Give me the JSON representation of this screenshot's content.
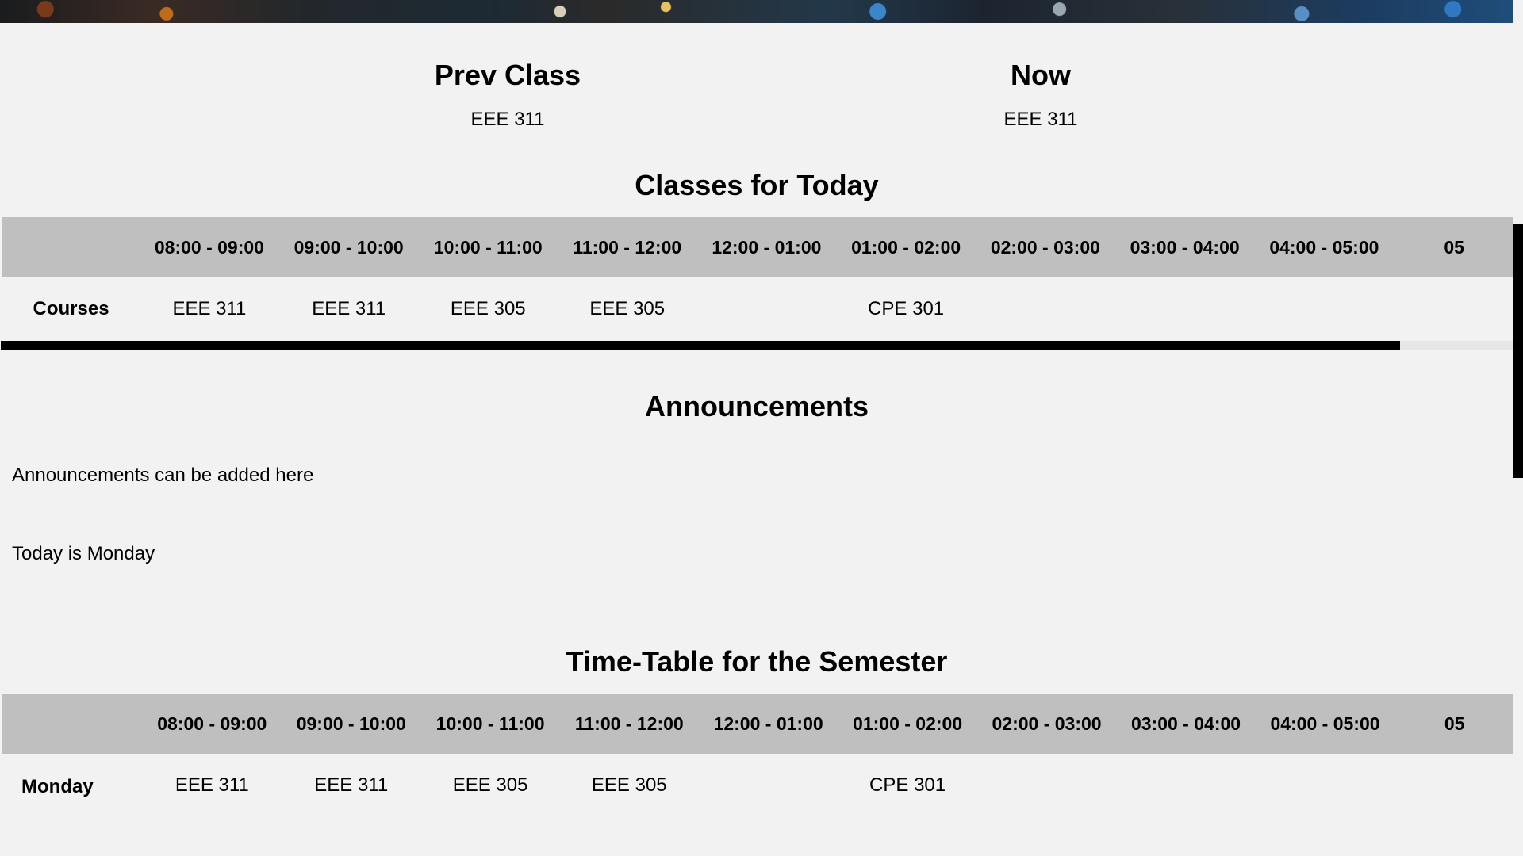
{
  "colors": {
    "page_background": "#f2f2f2",
    "table_header_background": "#bfbfbf",
    "scrollbar": "#000000"
  },
  "current_prev": {
    "prev_heading": "Prev Class",
    "prev_value": "EEE 311",
    "now_heading": "Now",
    "now_value": "EEE 311"
  },
  "today": {
    "title": "Classes for Today",
    "time_slots": [
      "08:00 - 09:00",
      "09:00 - 10:00",
      "10:00 - 11:00",
      "11:00 - 12:00",
      "12:00 - 01:00",
      "01:00 - 02:00",
      "02:00 - 03:00",
      "03:00 - 04:00",
      "04:00 - 05:00",
      "05"
    ],
    "row_label": "Courses",
    "courses": [
      "EEE 311",
      "EEE 311",
      "EEE 305",
      "EEE 305",
      "",
      "CPE 301",
      "",
      "",
      "",
      ""
    ]
  },
  "announcements": {
    "title": "Announcements",
    "text": "Announcements can be added here",
    "day_text": "Today is Monday"
  },
  "semester": {
    "title": "Time-Table for the Semester",
    "time_slots": [
      "08:00 - 09:00",
      "09:00 - 10:00",
      "10:00 - 11:00",
      "11:00 - 12:00",
      "12:00 - 01:00",
      "01:00 - 02:00",
      "02:00 - 03:00",
      "03:00 - 04:00",
      "04:00 - 05:00",
      "05"
    ],
    "rows": [
      {
        "day": "Monday",
        "courses": [
          "EEE 311",
          "EEE 311",
          "EEE 305",
          "EEE 305",
          "",
          "CPE 301",
          "",
          "",
          "",
          ""
        ]
      }
    ]
  }
}
